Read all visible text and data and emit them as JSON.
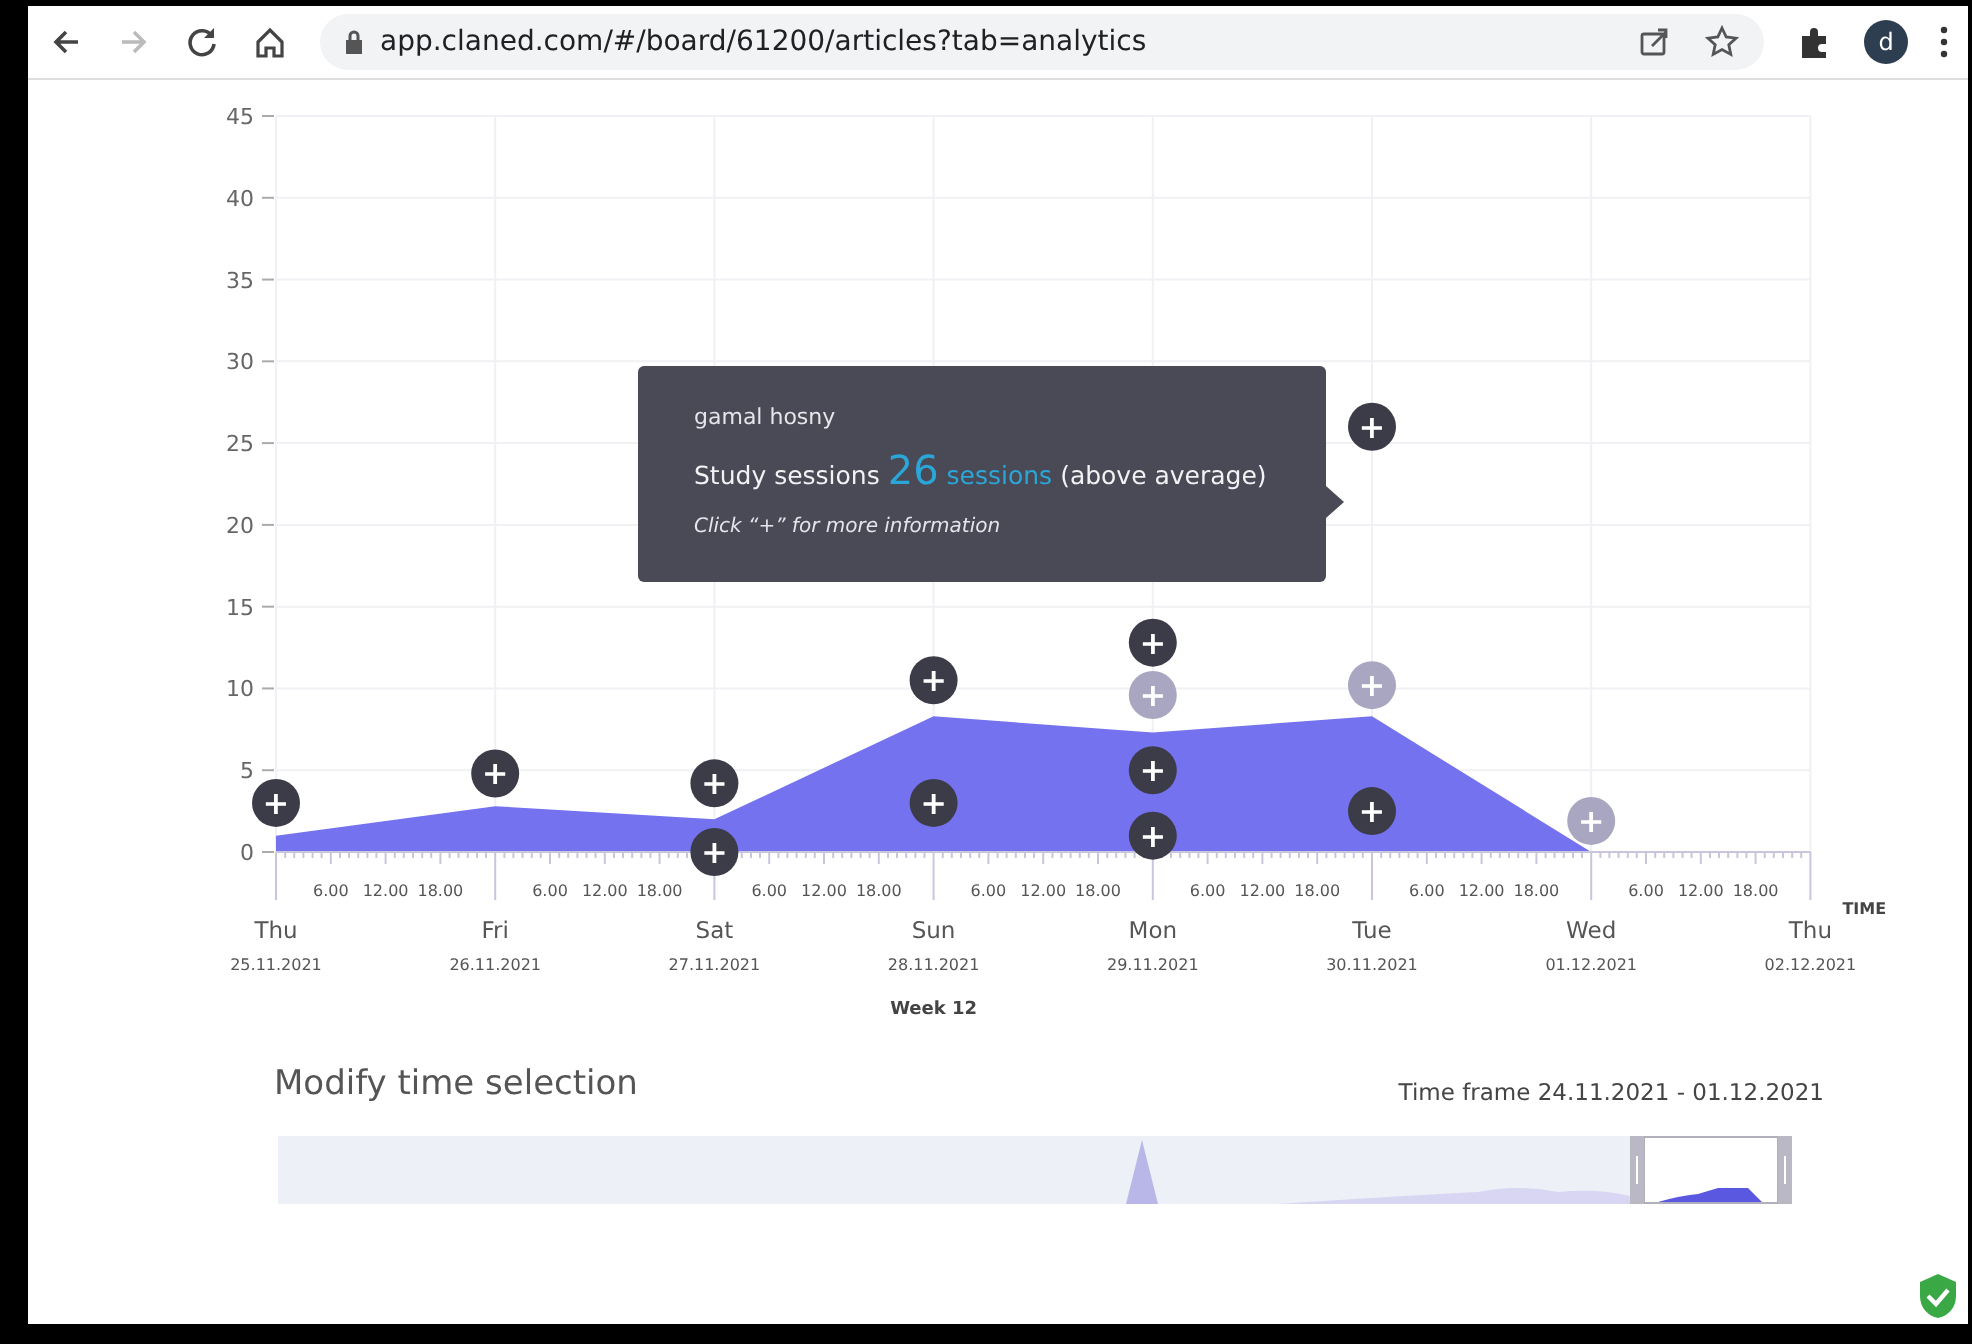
{
  "browser": {
    "url": "app.claned.com/#/board/61200/articles?tab=analytics",
    "forward_disabled": true,
    "profile_initial": "d"
  },
  "chart": {
    "chart_data": {
      "type": "area",
      "categories": [
        "Thu",
        "Fri",
        "Sat",
        "Sun",
        "Mon",
        "Tue",
        "Wed",
        "Thu"
      ],
      "series": [
        {
          "color": "#7472ee",
          "values": [
            1,
            2.8,
            2,
            8.3,
            7.3,
            8.3,
            0,
            null
          ]
        }
      ],
      "xlabel": "TIME",
      "ylim": [
        0,
        45
      ],
      "yticks": [
        0,
        5,
        10,
        15,
        20,
        25,
        30,
        35,
        40,
        45
      ],
      "grid": true,
      "annotations": [
        {
          "x": "Thu",
          "y": 3,
          "text": "+"
        },
        {
          "x": "Fri",
          "y": 4.8,
          "text": "+"
        },
        {
          "x": "Sat",
          "y": 4.2,
          "text": "+"
        },
        {
          "x": "Sat",
          "y": 0,
          "text": "+"
        },
        {
          "x": "Sun",
          "y": 10.5,
          "text": "+"
        },
        {
          "x": "Sun",
          "y": 3,
          "text": "+"
        },
        {
          "x": "Mon",
          "y": 12.8,
          "text": "+"
        },
        {
          "x": "Mon",
          "y": 9.6,
          "text": "+"
        },
        {
          "x": "Mon",
          "y": 5,
          "text": "+"
        },
        {
          "x": "Mon",
          "y": 1,
          "text": "+"
        },
        {
          "x": "Tue",
          "y": 10.2,
          "text": "+"
        },
        {
          "x": "Tue",
          "y": 2.5,
          "text": "+"
        },
        {
          "x": "Tue",
          "y": 26,
          "text": "+"
        },
        {
          "x": "Wed",
          "y": 1.9,
          "text": "+"
        }
      ]
    },
    "markers": [
      {
        "faded": false
      },
      {
        "faded": false
      },
      {
        "faded": false
      },
      {
        "faded": false
      },
      {
        "faded": false
      },
      {
        "faded": false
      },
      {
        "faded": false
      },
      {
        "faded": true
      },
      {
        "faded": false
      },
      {
        "faded": false
      },
      {
        "faded": true
      },
      {
        "faded": false
      },
      {
        "faded": false
      },
      {
        "faded": true
      }
    ],
    "date_labels": [
      "25.11.2021",
      "26.11.2021",
      "27.11.2021",
      "28.11.2021",
      "29.11.2021",
      "30.11.2021",
      "01.12.2021",
      "02.12.2021"
    ],
    "hour_ticks": [
      "6.00",
      "12.00",
      "18.00",
      "6.00",
      "12.00",
      "18.00",
      "6.00",
      "12.00",
      "18.00",
      "6.00",
      "12.00",
      "18.00",
      "6.00",
      "12.00",
      "18.00",
      "6.00",
      "12.00",
      "18.00",
      "6.00",
      "12.00",
      "18.00"
    ],
    "week_label": "Week 12",
    "tooltip": {
      "name": "gamal hosny",
      "prefix": "Study sessions",
      "count": "26",
      "unit": "sessions",
      "note": "(above average)",
      "hint": "Click “+” for more information"
    }
  },
  "time_selection": {
    "title": "Modify time selection",
    "time_frame": "Time frame 24.11.2021 - 01.12.2021"
  }
}
